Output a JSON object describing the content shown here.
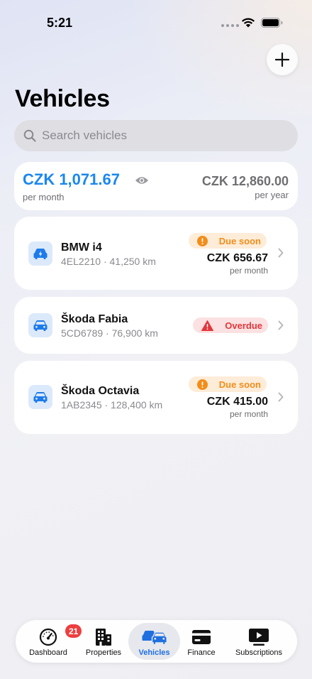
{
  "status_bar": {
    "time": "5:21"
  },
  "header": {
    "title": "Vehicles",
    "add_icon": "plus-icon"
  },
  "search": {
    "placeholder": "Search vehicles",
    "value": ""
  },
  "summary": {
    "monthly_total": "CZK 1,071.67",
    "monthly_label": "per month",
    "yearly_total": "CZK 12,860.00",
    "yearly_label": "per year"
  },
  "vehicles": [
    {
      "name": "BMW i4",
      "meta": "4EL2210 · 41,250 km",
      "icon": "electric-car-icon",
      "status": "Due soon",
      "status_type": "due",
      "amount": "CZK 656.67",
      "period": "per month"
    },
    {
      "name": "Škoda Fabia",
      "meta": "5CD6789 · 76,900 km",
      "icon": "car-icon",
      "status": "Overdue",
      "status_type": "overdue"
    },
    {
      "name": "Škoda Octavia",
      "meta": "1AB2345 · 128,400 km",
      "icon": "car-icon",
      "status": "Due soon",
      "status_type": "due",
      "amount": "CZK 415.00",
      "period": "per month"
    }
  ],
  "tabs": [
    {
      "label": "Dashboard",
      "icon": "speedometer-icon",
      "badge": "21"
    },
    {
      "label": "Properties",
      "icon": "building-icon"
    },
    {
      "label": "Vehicles",
      "icon": "cars-icon",
      "active": true
    },
    {
      "label": "Finance",
      "icon": "credit-card-icon"
    },
    {
      "label": "Subscriptions",
      "icon": "play-rectangle-icon"
    }
  ],
  "colors": {
    "accent": "#1a87f0",
    "tab_active": "#1f6fe0",
    "due_soon": "#f28d1a",
    "overdue": "#e2363b",
    "badge_red": "#ee3e3f"
  }
}
